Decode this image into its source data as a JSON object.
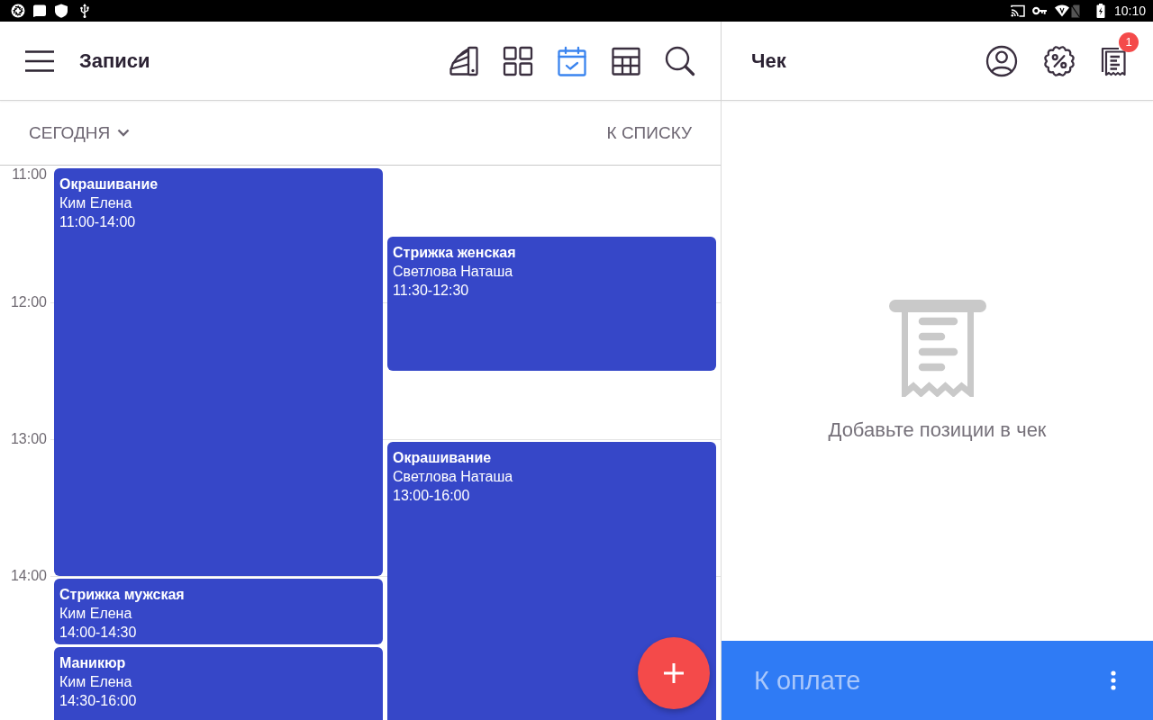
{
  "status_bar": {
    "time": "10:10"
  },
  "records": {
    "title": "Записи",
    "tools": [
      {
        "kind": "swatches",
        "selected": false
      },
      {
        "kind": "grid",
        "selected": false
      },
      {
        "kind": "calendar",
        "selected": true
      },
      {
        "kind": "table",
        "selected": false
      },
      {
        "kind": "search",
        "selected": false
      }
    ],
    "date_filter": "СЕГОДНЯ",
    "list_link": "К СПИСКУ",
    "calendar": {
      "hours": [
        "11:00",
        "12:00",
        "13:00",
        "14:00"
      ],
      "columns": [
        {
          "events": [
            {
              "title": "Окрашивание",
              "client": "Ким Елена",
              "time": "11:00-14:00"
            },
            {
              "title": "Стрижка мужская",
              "client": "Ким Елена",
              "time": "14:00-14:30"
            },
            {
              "title": "Маникюр",
              "client": "Ким Елена",
              "time": "14:30-16:00"
            }
          ]
        },
        {
          "events": [
            {
              "title": "Стрижка женская",
              "client": "Светлова Наташа",
              "time": "11:30-12:30"
            },
            {
              "title": "Окрашивание",
              "client": "Светлова Наташа",
              "time": "13:00-16:00"
            }
          ]
        }
      ]
    }
  },
  "receipt": {
    "title": "Чек",
    "count_badge": "1",
    "empty_message": "Добавьте позиции в чек",
    "pay_label": "К оплате"
  }
}
